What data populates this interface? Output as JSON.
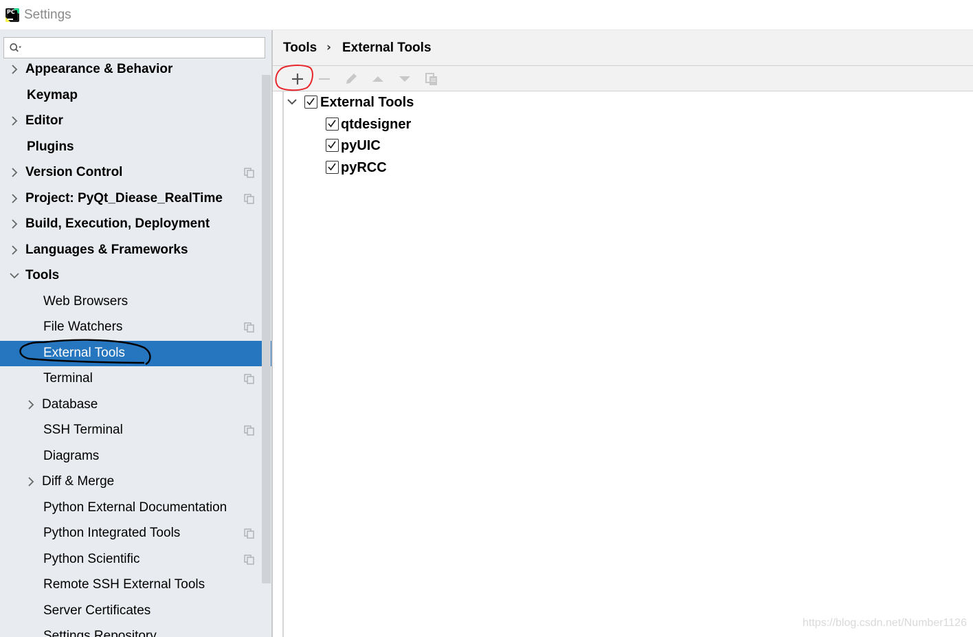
{
  "window": {
    "title": "Settings",
    "app_icon": "pycharm-icon"
  },
  "sidebar": {
    "search": {
      "value": "",
      "placeholder": ""
    },
    "items": [
      {
        "label": "Appearance & Behavior",
        "bold": true,
        "expandable": true,
        "expanded": false,
        "depth": 0,
        "project_level": false
      },
      {
        "label": "Keymap",
        "bold": true,
        "expandable": false,
        "depth": 0,
        "project_level": false
      },
      {
        "label": "Editor",
        "bold": true,
        "expandable": true,
        "expanded": false,
        "depth": 0,
        "project_level": false
      },
      {
        "label": "Plugins",
        "bold": true,
        "expandable": false,
        "depth": 0,
        "project_level": false
      },
      {
        "label": "Version Control",
        "bold": true,
        "expandable": true,
        "expanded": false,
        "depth": 0,
        "project_level": true
      },
      {
        "label": "Project: PyQt_Diease_RealTime",
        "bold": true,
        "expandable": true,
        "expanded": false,
        "depth": 0,
        "project_level": true
      },
      {
        "label": "Build, Execution, Deployment",
        "bold": true,
        "expandable": true,
        "expanded": false,
        "depth": 0,
        "project_level": false
      },
      {
        "label": "Languages & Frameworks",
        "bold": true,
        "expandable": true,
        "expanded": false,
        "depth": 0,
        "project_level": false
      },
      {
        "label": "Tools",
        "bold": true,
        "expandable": true,
        "expanded": true,
        "depth": 0,
        "project_level": false
      },
      {
        "label": "Web Browsers",
        "bold": false,
        "expandable": false,
        "depth": 1,
        "project_level": false
      },
      {
        "label": "File Watchers",
        "bold": false,
        "expandable": false,
        "depth": 1,
        "project_level": true
      },
      {
        "label": "External Tools",
        "bold": false,
        "expandable": false,
        "depth": 1,
        "project_level": false,
        "selected": true
      },
      {
        "label": "Terminal",
        "bold": false,
        "expandable": false,
        "depth": 1,
        "project_level": true
      },
      {
        "label": "Database",
        "bold": false,
        "expandable": true,
        "expanded": false,
        "depth": 1,
        "project_level": false
      },
      {
        "label": "SSH Terminal",
        "bold": false,
        "expandable": false,
        "depth": 1,
        "project_level": true
      },
      {
        "label": "Diagrams",
        "bold": false,
        "expandable": false,
        "depth": 1,
        "project_level": false
      },
      {
        "label": "Diff & Merge",
        "bold": false,
        "expandable": true,
        "expanded": false,
        "depth": 1,
        "project_level": false
      },
      {
        "label": "Python External Documentation",
        "bold": false,
        "expandable": false,
        "depth": 1,
        "project_level": false
      },
      {
        "label": "Python Integrated Tools",
        "bold": false,
        "expandable": false,
        "depth": 1,
        "project_level": true
      },
      {
        "label": "Python Scientific",
        "bold": false,
        "expandable": false,
        "depth": 1,
        "project_level": true
      },
      {
        "label": "Remote SSH External Tools",
        "bold": false,
        "expandable": false,
        "depth": 1,
        "project_level": false
      },
      {
        "label": "Server Certificates",
        "bold": false,
        "expandable": false,
        "depth": 1,
        "project_level": false
      },
      {
        "label": "Settings Repository",
        "bold": false,
        "expandable": false,
        "depth": 1,
        "project_level": false
      }
    ]
  },
  "breadcrumb": {
    "parent": "Tools",
    "separator": "›",
    "current": "External Tools"
  },
  "toolbar": {
    "buttons": [
      {
        "name": "add-icon",
        "enabled": true
      },
      {
        "name": "remove-icon",
        "enabled": false
      },
      {
        "name": "edit-icon",
        "enabled": false
      },
      {
        "name": "move-up-icon",
        "enabled": false
      },
      {
        "name": "move-down-icon",
        "enabled": false
      },
      {
        "name": "copy-icon",
        "enabled": false
      }
    ]
  },
  "external_tools": {
    "group": {
      "label": "External Tools",
      "checked": true,
      "expanded": true
    },
    "tools": [
      {
        "label": "qtdesigner",
        "checked": true
      },
      {
        "label": "pyUIC",
        "checked": true
      },
      {
        "label": "pyRCC",
        "checked": true
      }
    ]
  },
  "watermark": "https://blog.csdn.net/Number1126",
  "colors": {
    "selection": "#2675bf",
    "sidebar_bg": "#e8ecf0",
    "toolbar_bg": "#f2f2f2",
    "annotation_red": "#e8262c",
    "annotation_black": "#000000"
  }
}
